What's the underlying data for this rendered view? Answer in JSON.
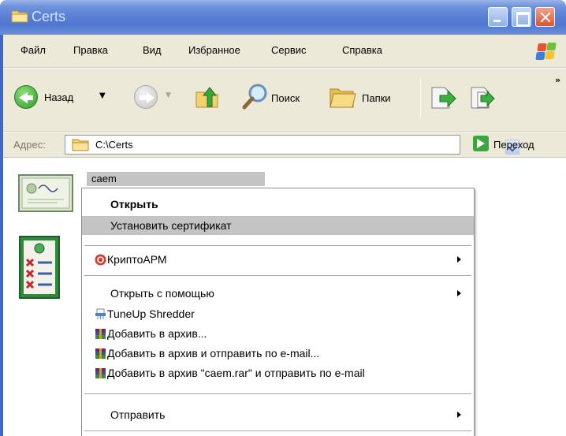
{
  "window": {
    "title": "Certs"
  },
  "menu": [
    "Файл",
    "Правка",
    "Вид",
    "Избранное",
    "Сервис",
    "Справка"
  ],
  "toolbar": {
    "back_label": "Назад",
    "search_label": "Поиск",
    "folders_label": "Папки",
    "overflow": "»"
  },
  "address": {
    "label": "Адрес:",
    "value": "C:\\Certs",
    "go_label": "Переход"
  },
  "file": {
    "name": "caem"
  },
  "context_menu": {
    "open": "Открыть",
    "install_cert": "Установить сертификат",
    "cryptoarm": "КриптоАРМ",
    "open_with": "Открыть с помощью",
    "tuneup": "TuneUp Shredder",
    "add_archive": "Добавить в архив...",
    "add_archive_email": "Добавить в архив и отправить по e-mail...",
    "add_rar_email": "Добавить в архив \"caem.rar\" и отправить по e-mail",
    "send_to": "Отправить"
  },
  "colors": {
    "titlebar": "#5b82d6",
    "chrome": "#ece9d8",
    "selection": "#c4c4c4",
    "go_green": "#3aa640"
  }
}
